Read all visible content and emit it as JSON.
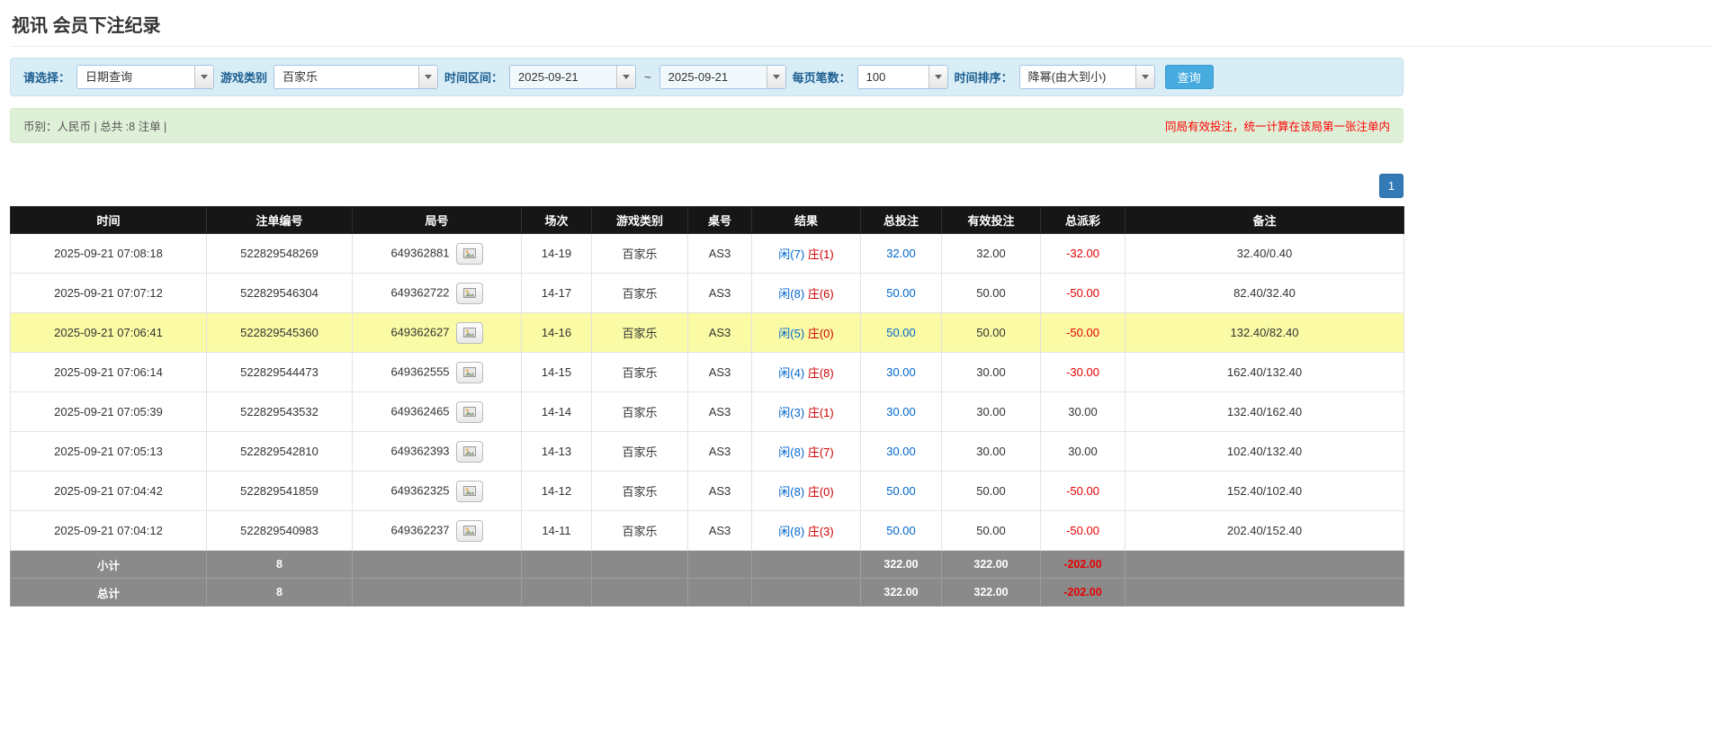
{
  "page": {
    "title": "视讯 会员下注纪录"
  },
  "filters": {
    "select_label": "请选择：",
    "select_value": "日期查询",
    "game_type_label": "游戏类别",
    "game_type_value": "百家乐",
    "time_range_label": "时间区间：",
    "date_from": "2025-09-21",
    "range_separator": "~",
    "date_to": "2025-09-21",
    "page_size_label": "每页笔数：",
    "page_size_value": "100",
    "sort_label": "时间排序：",
    "sort_value": "降幂(由大到小)",
    "search_button_label": "查询"
  },
  "summary": {
    "info_left": "币别：人民币 | 总共 :8 注单 |",
    "notice_right": "同局有效投注，统一计算在该局第一张注单内"
  },
  "pagination": {
    "current_page": "1"
  },
  "table": {
    "headers": [
      "时间",
      "注单编号",
      "局号",
      "场次",
      "游戏类别",
      "桌号",
      "结果",
      "总投注",
      "有效投注",
      "总派彩",
      "备注"
    ],
    "rows": [
      {
        "time": "2025-09-21 07:08:18",
        "bet_id": "522829548269",
        "round": "649362881",
        "session": "14-19",
        "game": "百家乐",
        "table_no": "AS3",
        "player": "闲(7)",
        "banker": "庄(1)",
        "total_bet": "32.00",
        "valid_bet": "32.00",
        "payout": "-32.00",
        "note": "32.40/0.40",
        "highlight": false
      },
      {
        "time": "2025-09-21 07:07:12",
        "bet_id": "522829546304",
        "round": "649362722",
        "session": "14-17",
        "game": "百家乐",
        "table_no": "AS3",
        "player": "闲(8)",
        "banker": "庄(6)",
        "total_bet": "50.00",
        "valid_bet": "50.00",
        "payout": "-50.00",
        "note": "82.40/32.40",
        "highlight": false
      },
      {
        "time": "2025-09-21 07:06:41",
        "bet_id": "522829545360",
        "round": "649362627",
        "session": "14-16",
        "game": "百家乐",
        "table_no": "AS3",
        "player": "闲(5)",
        "banker": "庄(0)",
        "total_bet": "50.00",
        "valid_bet": "50.00",
        "payout": "-50.00",
        "note": "132.40/82.40",
        "highlight": true
      },
      {
        "time": "2025-09-21 07:06:14",
        "bet_id": "522829544473",
        "round": "649362555",
        "session": "14-15",
        "game": "百家乐",
        "table_no": "AS3",
        "player": "闲(4)",
        "banker": "庄(8)",
        "total_bet": "30.00",
        "valid_bet": "30.00",
        "payout": "-30.00",
        "note": "162.40/132.40",
        "highlight": false
      },
      {
        "time": "2025-09-21 07:05:39",
        "bet_id": "522829543532",
        "round": "649362465",
        "session": "14-14",
        "game": "百家乐",
        "table_no": "AS3",
        "player": "闲(3)",
        "banker": "庄(1)",
        "total_bet": "30.00",
        "valid_bet": "30.00",
        "payout": "30.00",
        "note": "132.40/162.40",
        "highlight": false
      },
      {
        "time": "2025-09-21 07:05:13",
        "bet_id": "522829542810",
        "round": "649362393",
        "session": "14-13",
        "game": "百家乐",
        "table_no": "AS3",
        "player": "闲(8)",
        "banker": "庄(7)",
        "total_bet": "30.00",
        "valid_bet": "30.00",
        "payout": "30.00",
        "note": "102.40/132.40",
        "highlight": false
      },
      {
        "time": "2025-09-21 07:04:42",
        "bet_id": "522829541859",
        "round": "649362325",
        "session": "14-12",
        "game": "百家乐",
        "table_no": "AS3",
        "player": "闲(8)",
        "banker": "庄(0)",
        "total_bet": "50.00",
        "valid_bet": "50.00",
        "payout": "-50.00",
        "note": "152.40/102.40",
        "highlight": false
      },
      {
        "time": "2025-09-21 07:04:12",
        "bet_id": "522829540983",
        "round": "649362237",
        "session": "14-11",
        "game": "百家乐",
        "table_no": "AS3",
        "player": "闲(8)",
        "banker": "庄(3)",
        "total_bet": "50.00",
        "valid_bet": "50.00",
        "payout": "-50.00",
        "note": "202.40/152.40",
        "highlight": false
      }
    ],
    "subtotal": {
      "label": "小计",
      "count": "8",
      "total_bet": "322.00",
      "valid_bet": "322.00",
      "payout": "-202.00"
    },
    "grand_total": {
      "label": "总计",
      "count": "8",
      "total_bet": "322.00",
      "valid_bet": "322.00",
      "payout": "-202.00"
    }
  },
  "colors": {
    "accent_blue": "#337ab7",
    "link_blue": "#0066cc",
    "negative_red": "#e60000",
    "player_blue": "#0066cc",
    "banker_red": "#cc0000",
    "highlight_yellow": "#fbfba5",
    "header_black": "#161616",
    "footer_gray": "#8a8a8a"
  }
}
